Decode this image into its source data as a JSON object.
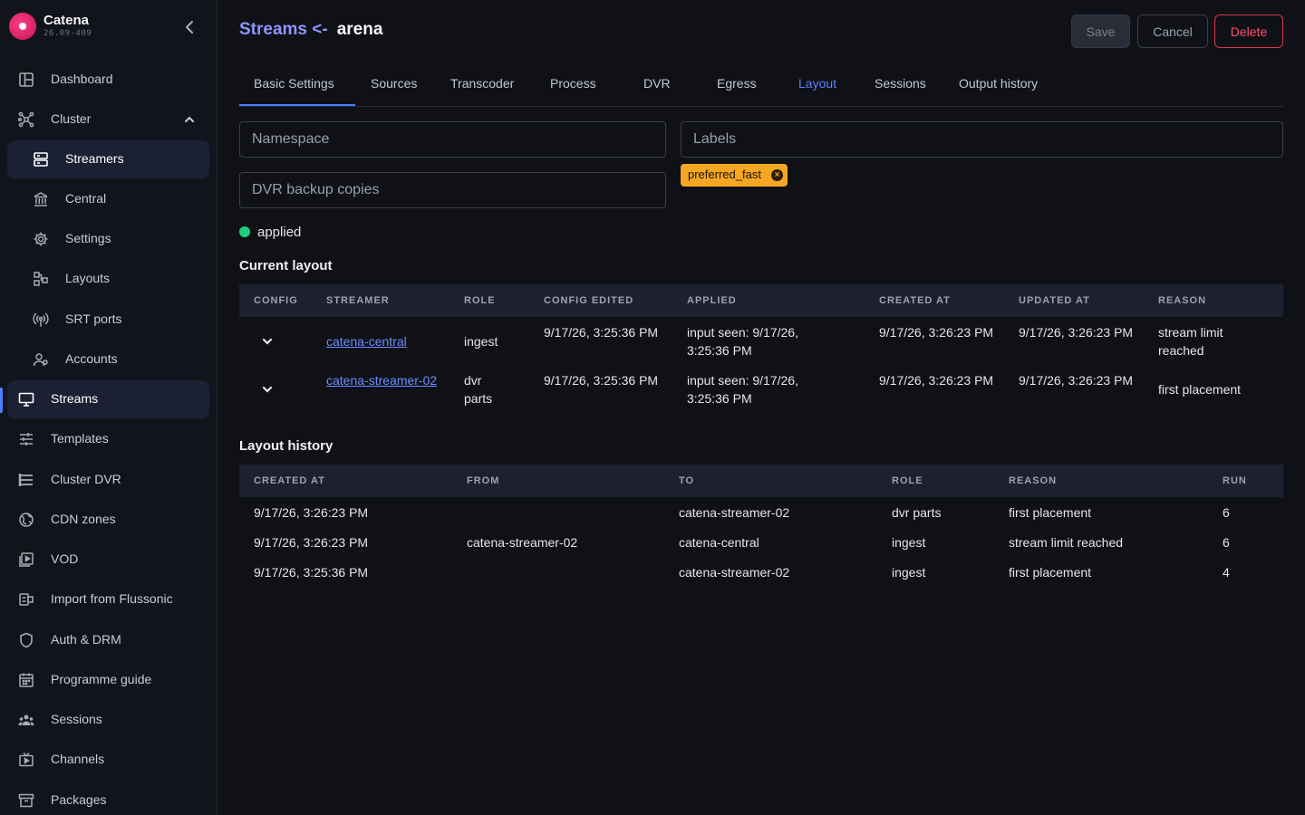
{
  "brand": {
    "name": "Catena",
    "version": "26.09-409"
  },
  "sidebar": {
    "items": [
      {
        "label": "Dashboard",
        "icon": "dashboard-icon"
      },
      {
        "label": "Cluster",
        "icon": "cluster-icon"
      },
      {
        "label": "Streamers",
        "icon": "server-icon"
      },
      {
        "label": "Central",
        "icon": "bank-icon"
      },
      {
        "label": "Settings",
        "icon": "gear-icon"
      },
      {
        "label": "Layouts",
        "icon": "layouts-icon"
      },
      {
        "label": "SRT ports",
        "icon": "broadcast-icon"
      },
      {
        "label": "Accounts",
        "icon": "accounts-icon"
      },
      {
        "label": "Streams",
        "icon": "monitor-icon"
      },
      {
        "label": "Templates",
        "icon": "sliders-icon"
      },
      {
        "label": "Cluster DVR",
        "icon": "list-icon"
      },
      {
        "label": "CDN zones",
        "icon": "globe-icon"
      },
      {
        "label": "VOD",
        "icon": "video-library-icon"
      },
      {
        "label": "Import from Flussonic",
        "icon": "import-icon"
      },
      {
        "label": "Auth & DRM",
        "icon": "shield-icon"
      },
      {
        "label": "Programme guide",
        "icon": "calendar-icon"
      },
      {
        "label": "Sessions",
        "icon": "people-icon"
      },
      {
        "label": "Channels",
        "icon": "tv-icon"
      },
      {
        "label": "Packages",
        "icon": "archive-icon"
      }
    ]
  },
  "header": {
    "crumb": "Streams <-",
    "stream_name": "arena",
    "save_label": "Save",
    "cancel_label": "Cancel",
    "delete_label": "Delete"
  },
  "tabs": [
    "Basic Settings",
    "Sources",
    "Transcoder",
    "Process",
    "DVR",
    "Egress",
    "Layout",
    "Sessions",
    "Output history"
  ],
  "form": {
    "namespace_placeholder": "Namespace",
    "labels_placeholder": "Labels",
    "dvr_backup_placeholder": "DVR backup copies",
    "label_chip": "preferred_fast",
    "status": "applied"
  },
  "current_layout": {
    "title": "Current layout",
    "columns": [
      "CONFIG",
      "STREAMER",
      "ROLE",
      "CONFIG EDITED",
      "APPLIED",
      "CREATED AT",
      "UPDATED AT",
      "REASON"
    ],
    "rows": [
      {
        "streamer": "catena-central",
        "role": "ingest",
        "config_edited": "9/17/26, 3:25:36 PM",
        "applied": "input seen: 9/17/26, 3:25:36 PM",
        "created_at": "9/17/26, 3:26:23 PM",
        "updated_at": "9/17/26, 3:26:23 PM",
        "reason": "stream limit reached"
      },
      {
        "streamer": "catena-streamer-02",
        "role": "dvr parts",
        "config_edited": "9/17/26, 3:25:36 PM",
        "applied": "input seen: 9/17/26, 3:25:36 PM",
        "created_at": "9/17/26, 3:26:23 PM",
        "updated_at": "9/17/26, 3:26:23 PM",
        "reason": "first placement"
      }
    ]
  },
  "layout_history": {
    "title": "Layout history",
    "columns": [
      "CREATED AT",
      "FROM",
      "TO",
      "ROLE",
      "REASON",
      "RUN"
    ],
    "rows": [
      {
        "created_at": "9/17/26, 3:26:23 PM",
        "from": "",
        "to": "catena-streamer-02",
        "role": "dvr parts",
        "reason": "first placement",
        "run": "6"
      },
      {
        "created_at": "9/17/26, 3:26:23 PM",
        "from": "catena-streamer-02",
        "to": "catena-central",
        "role": "ingest",
        "reason": "stream limit reached",
        "run": "6"
      },
      {
        "created_at": "9/17/26, 3:25:36 PM",
        "from": "",
        "to": "catena-streamer-02",
        "role": "ingest",
        "reason": "first placement",
        "run": "4"
      }
    ]
  },
  "colors": {
    "accent": "#4d7dff",
    "danger": "#ff4f6a",
    "chip": "#f5a623",
    "status_ok": "#1fcf7e"
  }
}
